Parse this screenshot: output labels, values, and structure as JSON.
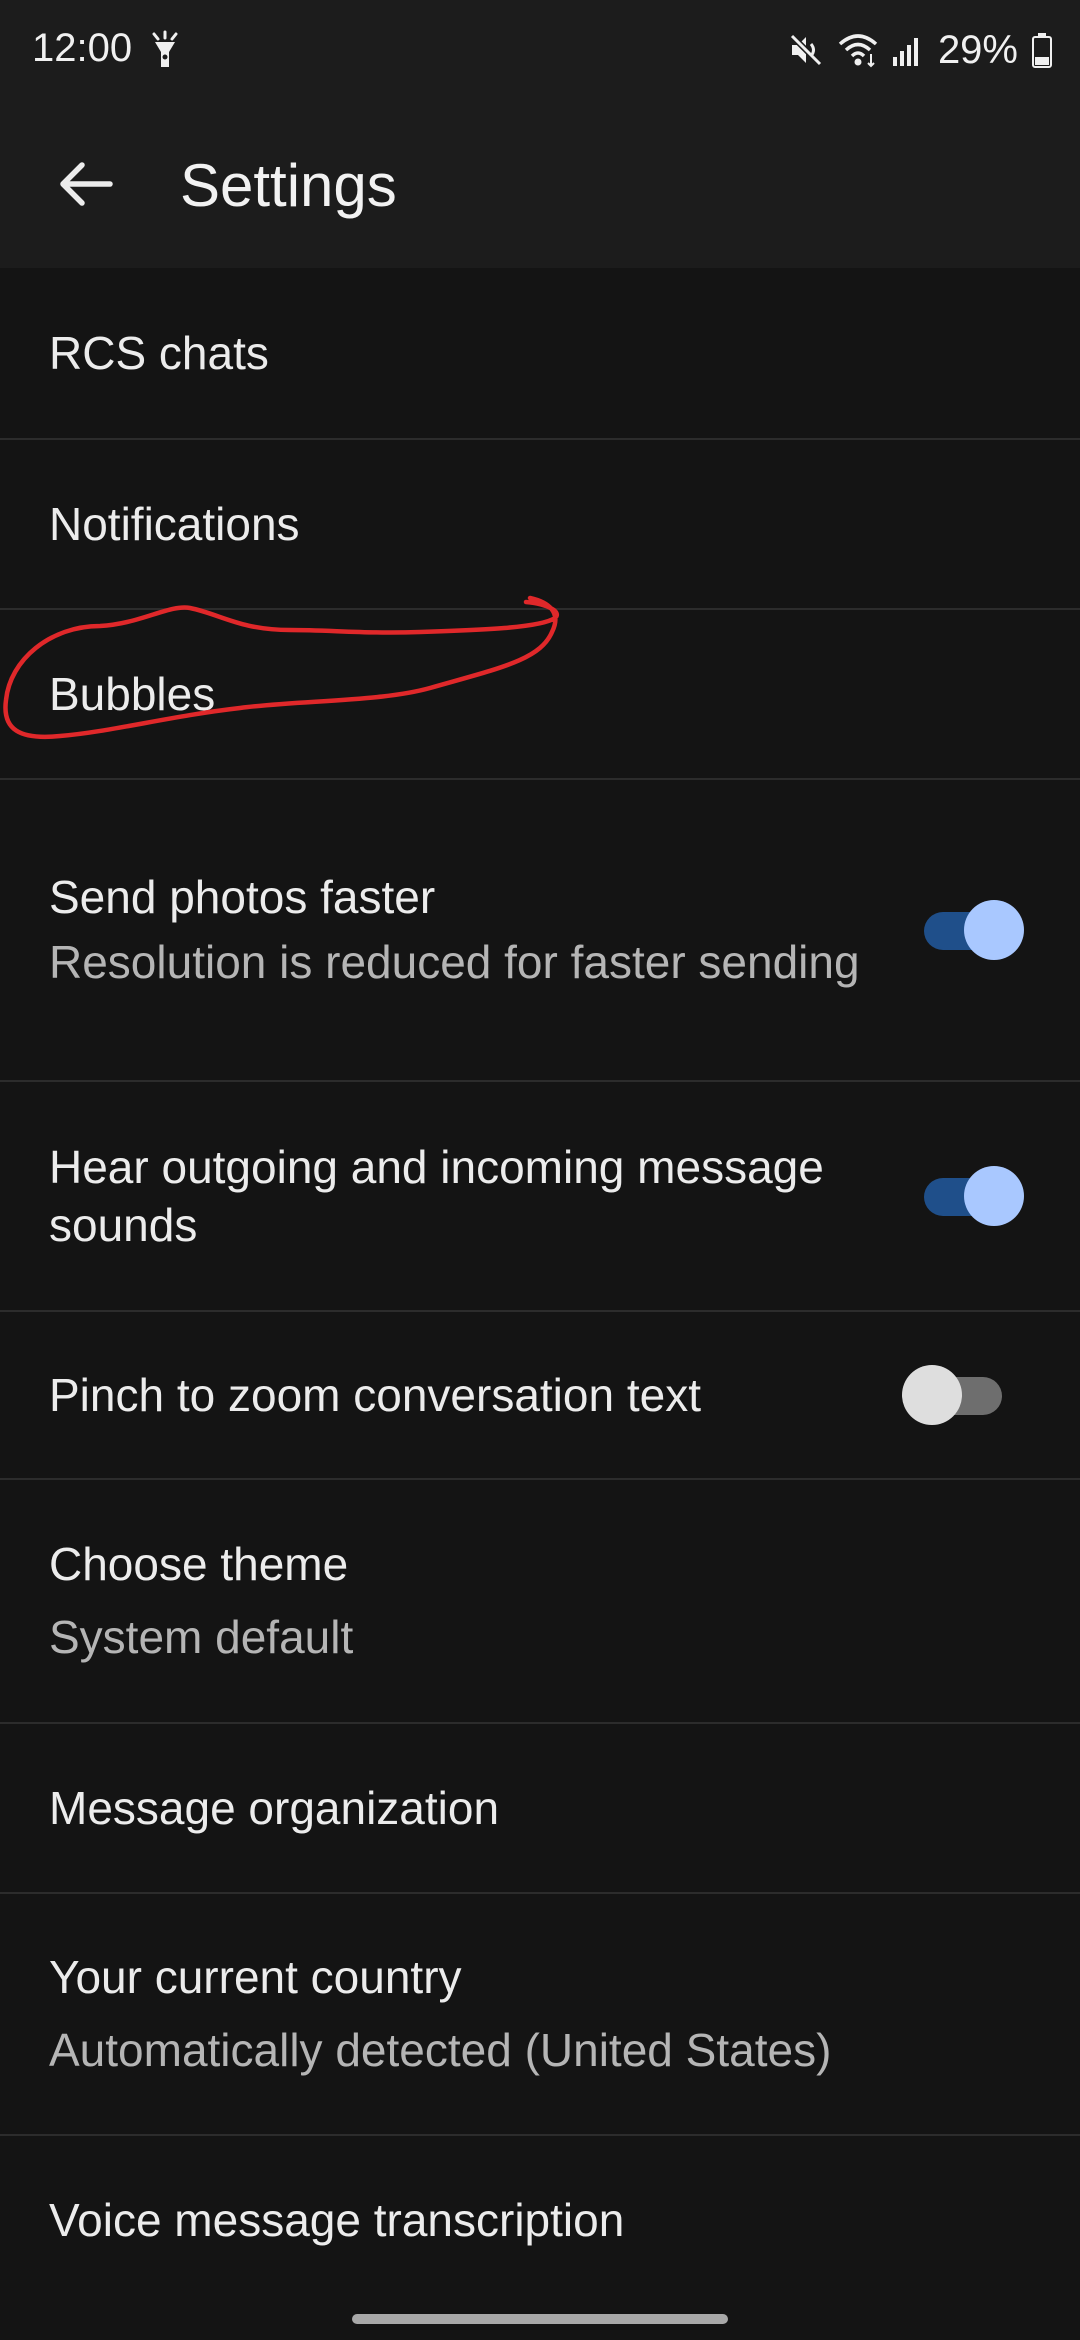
{
  "status": {
    "time": "12:00",
    "battery": "29%",
    "icons": [
      "flashlight-icon",
      "mute-icon",
      "wifi-icon",
      "signal-icon",
      "battery-icon"
    ]
  },
  "appbar": {
    "title": "Settings",
    "back_icon": "arrow-back-icon"
  },
  "settings": [
    {
      "title": "RCS chats"
    },
    {
      "title": "Notifications"
    },
    {
      "title": "Bubbles"
    },
    {
      "title": "Send photos faster",
      "subtitle": "Resolution is reduced for faster sending",
      "toggle": true
    },
    {
      "title": "Hear outgoing and incoming message sounds",
      "toggle": true
    },
    {
      "title": "Pinch to zoom conversation text",
      "toggle": false
    },
    {
      "title": "Choose theme",
      "subtitle": "System default"
    },
    {
      "title": "Message organization"
    },
    {
      "title": "Your current country",
      "subtitle": "Automatically detected (United States)"
    },
    {
      "title": "Voice message transcription"
    }
  ],
  "colors": {
    "background": "#141414",
    "bar": "#1c1c1c",
    "toggle_on_track": "#1f4f8a",
    "toggle_on_thumb": "#a9c8ff",
    "annotation": "#e0282a"
  }
}
